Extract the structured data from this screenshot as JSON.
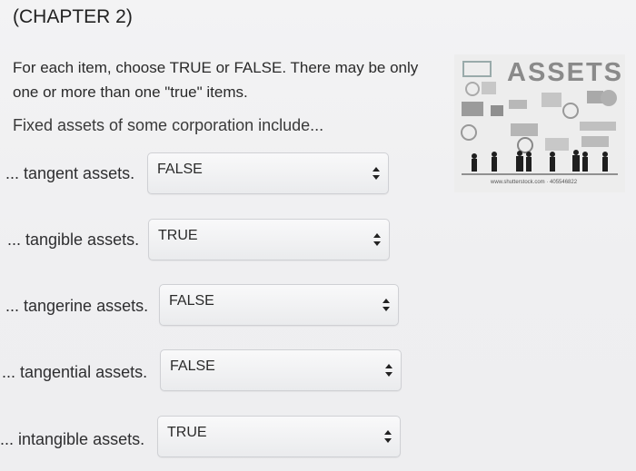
{
  "header": {
    "title": "(CHAPTER 2)"
  },
  "instructions": "For each item, choose TRUE or FALSE. There may be only one or more than one \"true\" items.",
  "question": "Fixed assets of some corporation include...",
  "items": [
    {
      "label": "... tangent assets.",
      "value": "FALSE"
    },
    {
      "label": "... tangible assets.",
      "value": "TRUE"
    },
    {
      "label": "... tangerine assets.",
      "value": "FALSE"
    },
    {
      "label": "... tangential assets.",
      "value": "FALSE"
    },
    {
      "label": "... intangible assets.",
      "value": "TRUE"
    }
  ],
  "image": {
    "heading": "ASSETS",
    "credit": "www.shutterstock.com · 405546822"
  },
  "colors": {
    "select_border": "#cfd0d4",
    "image_heading": "#8a8a8a"
  }
}
